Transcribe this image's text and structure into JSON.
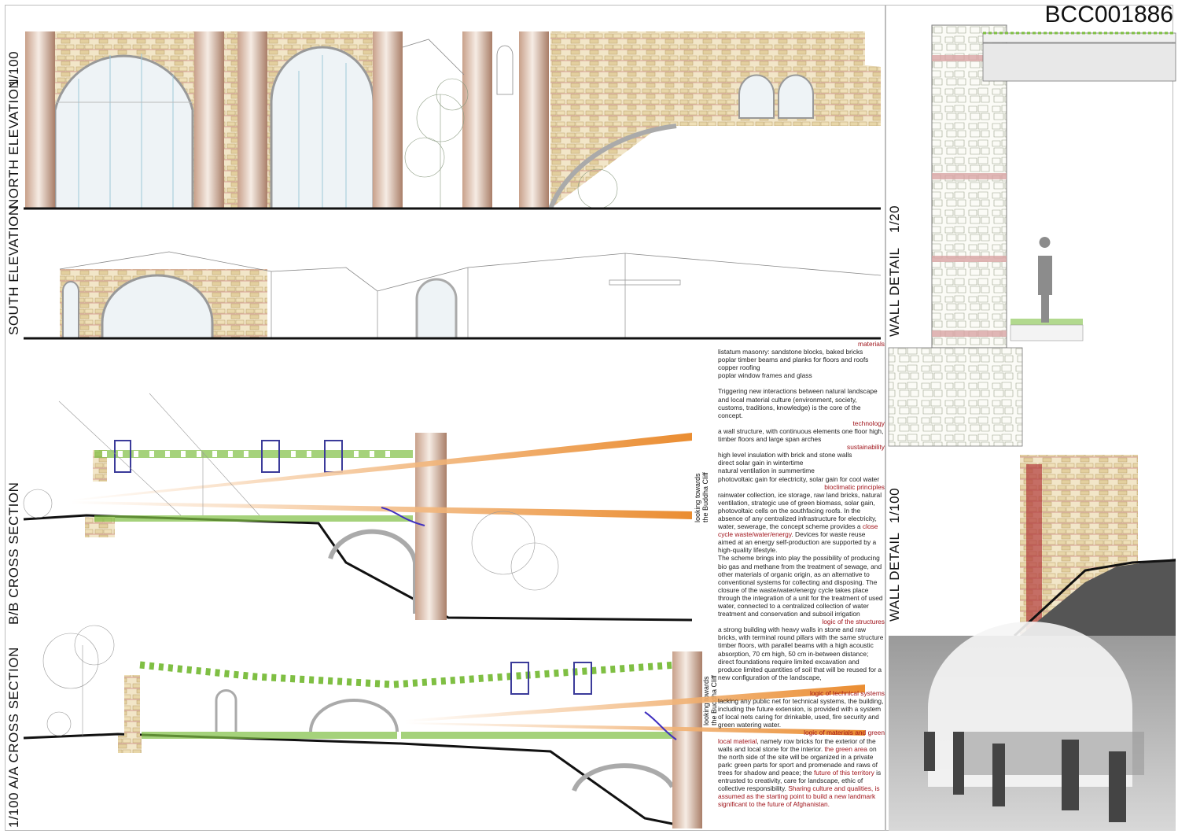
{
  "code": "BCC001886",
  "labels": {
    "scale_elevation": "1/100",
    "north_elevation": "NORTH ELEVATION",
    "south_elevation": "SOUTH ELEVATION",
    "bb_section": "B/B CROSS SECTION",
    "aa_section": "1/100 A/A CROSS SECTION",
    "wall_detail_1": "WALL  DETAIL",
    "wall_detail_1_scale": "1/20",
    "wall_detail_2": "WALL  DETAIL",
    "wall_detail_2_scale": "1/100",
    "looking_1_line1": "looking towards",
    "looking_1_line2": "the Buddha Cliff",
    "looking_2_line1": "looking towards",
    "looking_2_line2": "the Buddha Cliff"
  },
  "text": {
    "materials_h": "materials",
    "materials_1": "listatum masonry: sandstone blocks, baked bricks",
    "materials_2": "poplar timber beams and planks for floors and roofs",
    "materials_3": "copper roofing",
    "materials_4": "poplar window frames and glass",
    "concept": "Triggering new interactions between natural landscape and local material culture (environment, society, customs, traditions, knowledge) is the core of the concept.",
    "technology_h": "technology",
    "technology": "a wall structure, with continuous elements one floor high, timber floors and large span arches",
    "sustainability_h": "sustainability",
    "sust_1": "high level insulation with brick and stone walls",
    "sust_2": "direct solar gain in wintertime",
    "sust_3": "natural ventilation in summertime",
    "sust_4": "photovoltaic gain for electricity, solar gain for cool water",
    "bio_h": "bioclimatic principles",
    "bio_1": "rainwater collection, ice storage, raw land bricks, natural ventilation, strategic use of green biomass, solar gain, photovoltaic cells on the southfacing roofs. In the absence of any centralized infrastructure for electricity, water, sewerage, the concept scheme provides a",
    "bio_red": "close cycle waste/water/energy",
    "bio_2": ". Devices for waste reuse aimed at an energy self-production are supported by a high-quality lifestyle.",
    "bio_3": "The scheme brings into play the possibility of producing bio gas and methane from the treatment of sewage, and other materials of organic origin, as an alternative to conventional systems for collecting and disposing. The closure of the waste/water/energy cycle takes place through the integration of a unit for the treatment of used water, connected to a centralized collection of water treatment and conservation and subsoil irrigation",
    "struct_h": "logic of the structures",
    "struct_1": "a strong building with heavy walls in stone and raw bricks, with terminal round pillars with the same structure",
    "struct_2": "timber floors, with parallel beams with a high acoustic absorption, 70 cm high, 50 cm in-between distance; direct foundations require limited excavation and produce limited quantities of soil that will be reused for a new configuration of the landscape,",
    "tech_h": "logic of technical systems",
    "tech_1": "lacking any public net for technical systems, the building, including the future extension, is provided with a system of local nets caring for drinkable, used, fire security and green watering water.",
    "matgreen_h": "logic of materials and green",
    "mg_red1": "local material",
    "mg_1": ", namely row bricks for the exterior of the walls and local stone for the interior.",
    "mg_red2": "the green area",
    "mg_2": " on the north side of the site will be organized in a private park: green  parts for sport and promenade and raws of trees for shadow and peace; the",
    "mg_red3": "future of this territory",
    "mg_3": " is entrusted to creativity, care for landscape, ethic of collective responsibility.",
    "mg_red4": "Sharing culture and qualities, is assumed as the starting point to build a new landmark significant to the future of Afghanistan."
  }
}
